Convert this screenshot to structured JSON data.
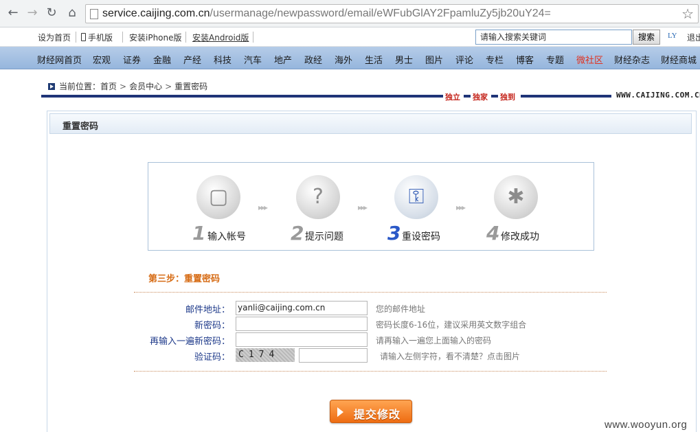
{
  "browser": {
    "url_host": "service.caijing.com.cn",
    "url_path": "/usermanage/newpassword/email/eWFubGlAY2FpamluZy5jb20uY24="
  },
  "topbar": {
    "set_home": "设为首页",
    "mobile": "手机版",
    "iphone": "安装iPhone版",
    "android": "安装Android版",
    "search_placeholder": "请输入搜索关键词",
    "search_btn": "搜索",
    "ly": "LY",
    "logout": "退出"
  },
  "nav": {
    "items": [
      "财经网首页",
      "宏观",
      "证券",
      "金融",
      "产经",
      "科技",
      "汽车",
      "地产",
      "政经",
      "海外",
      "生活",
      "男士",
      "图片",
      "评论",
      "专栏",
      "博客",
      "专题",
      "微社区",
      "财经杂志",
      "财经商城"
    ],
    "highlight_color": "#e0301e"
  },
  "breadcrumb": {
    "prefix": "当前位置：",
    "home": "首页",
    "member": "会员中心",
    "current": "重置密码"
  },
  "slogan": [
    "独立",
    "独家",
    "独到"
  ],
  "brand": "WWW.CAIJING.COM.CN",
  "panel": {
    "title": "重置密码"
  },
  "steps": [
    {
      "num": "1",
      "label": "输入帐号",
      "icon": "computer-icon"
    },
    {
      "num": "2",
      "label": "提示问题",
      "icon": "question-book-icon"
    },
    {
      "num": "3",
      "label": "重设密码",
      "icon": "lock-key-icon",
      "active": true
    },
    {
      "num": "4",
      "label": "修改成功",
      "icon": "gift-box-icon"
    }
  ],
  "form": {
    "step_title": "第三步：重置密码",
    "email_label": "邮件地址：",
    "email_value": "yanli@caijing.com.cn",
    "email_hint": "您的邮件地址",
    "pwd_label": "新密码：",
    "pwd_hint": "密码长度6-16位，建议采用英文数字组合",
    "pwd2_label": "再输入一遍新密码：",
    "pwd2_hint": "请再输入一遍您上面输入的密码",
    "captcha_label": "验证码：",
    "captcha_text": "C174",
    "captcha_hint": "请输入左侧字符，看不清楚？点击图片",
    "submit": "提交修改"
  },
  "watermark": "www.wooyun.org"
}
